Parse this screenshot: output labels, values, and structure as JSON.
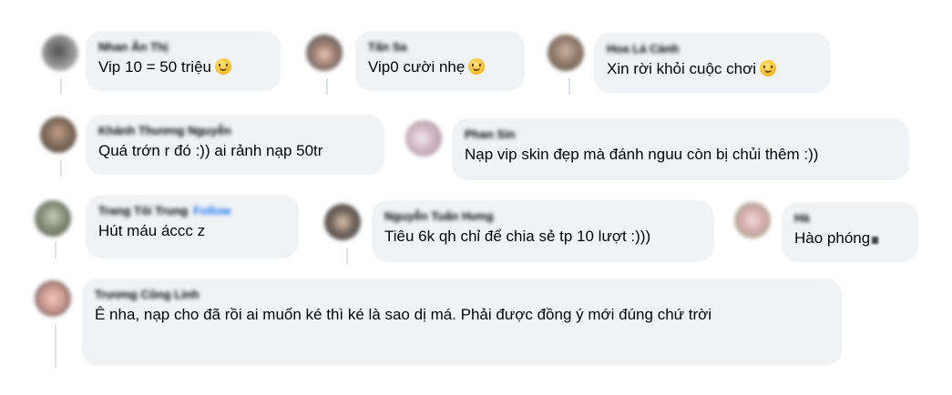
{
  "comments": [
    {
      "author": "Nhan Ân Thị",
      "text": "Vip 10 = 50 triệu",
      "emoji": "smiling-face-icon"
    },
    {
      "author": "Tấn Sa",
      "text": "Vip0 cười nhẹ",
      "emoji": "grinning-face-icon"
    },
    {
      "author": "Hoa Lá Cành",
      "text": "Xin rời khỏi cuộc chơi",
      "emoji": "relieved-face-icon"
    },
    {
      "author": "Khánh Thương Nguyễn",
      "text": "Quá trớn r đó :)) ai rảnh nạp 50tr"
    },
    {
      "author": "Phan Sin",
      "text": "Nạp vip skin đẹp mà đánh nguu còn bị chủi thêm :))"
    },
    {
      "author": "Trang Tôi Trung",
      "follow": "Follow",
      "text": "Hút máu áccc z"
    },
    {
      "author": "Nguyễn Tuấn Hưng",
      "text": "Tiêu 6k qh chỉ để chia sẻ tp 10 lượt :)))"
    },
    {
      "author": "Hà",
      "text": "Hào phóng"
    },
    {
      "author": "Trương Công Linh",
      "text": "Ê nha, nạp cho đã rồi ai muốn ké thì ké là sao dị má. Phải được đồng ý mới đúng chứ trời"
    }
  ]
}
